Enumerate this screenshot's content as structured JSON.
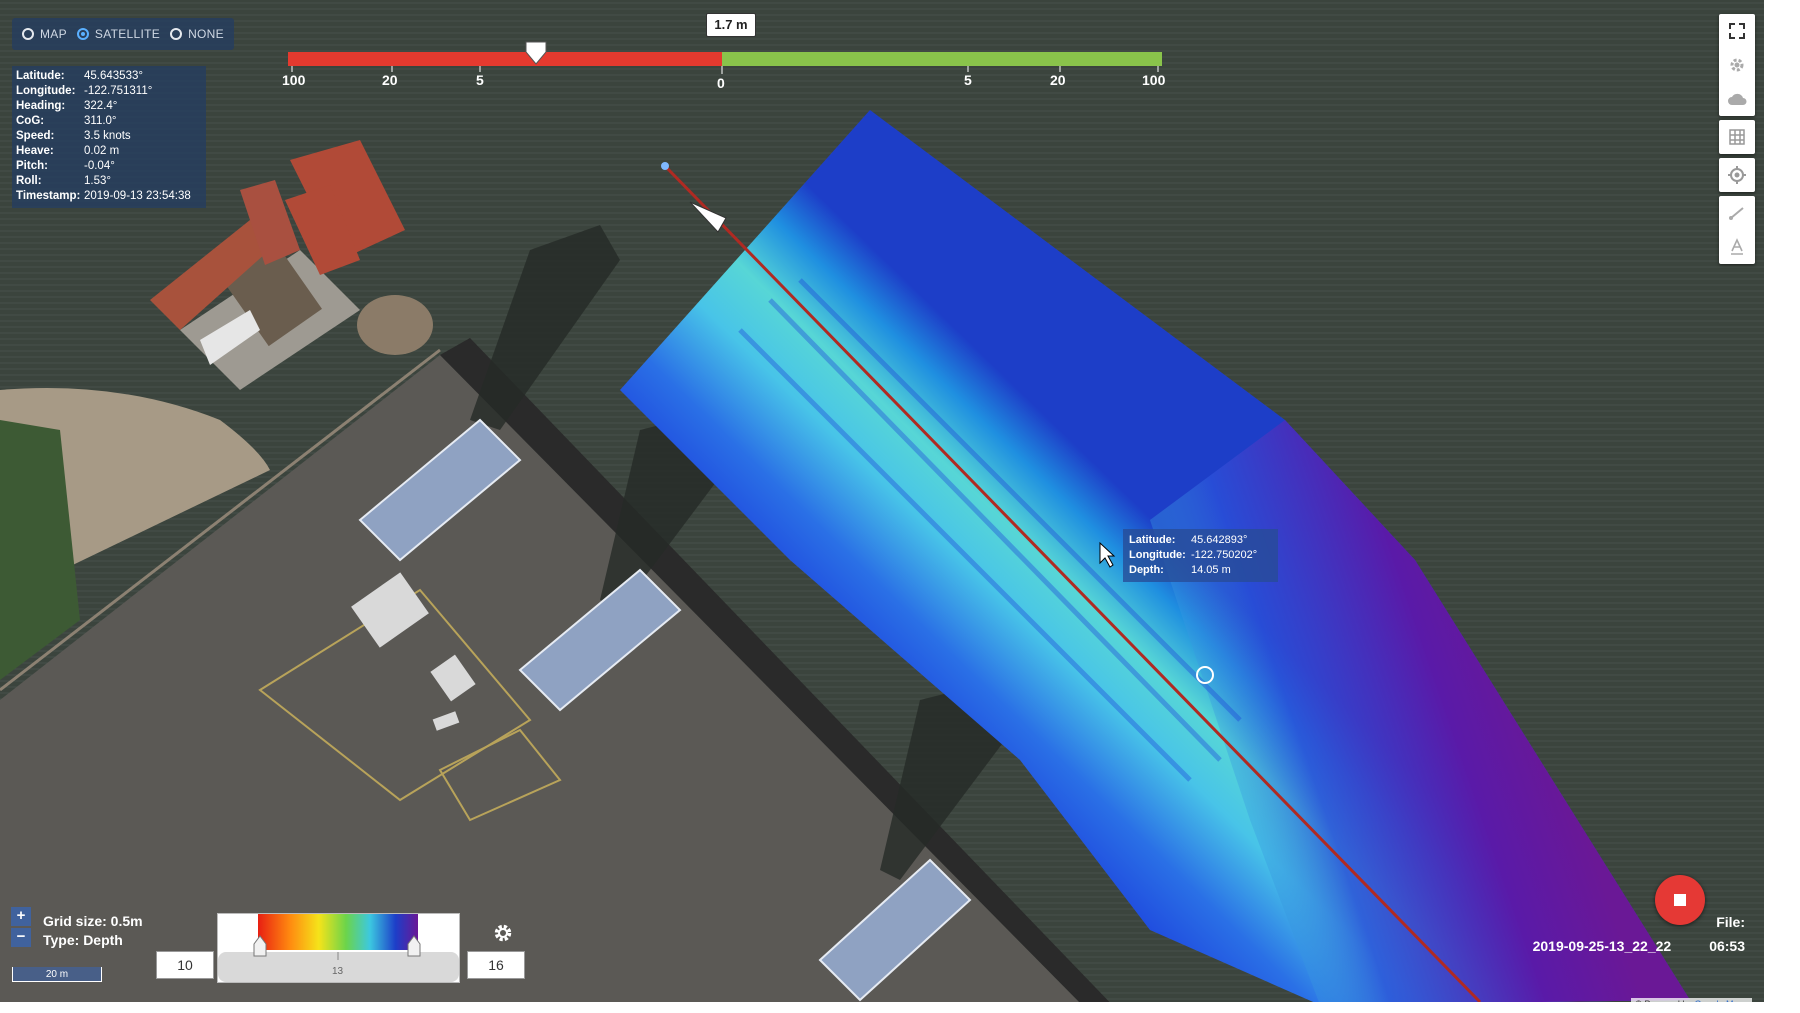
{
  "layer_bar": {
    "options": [
      {
        "label": "MAP",
        "selected": false
      },
      {
        "label": "SATELLITE",
        "selected": true
      },
      {
        "label": "NONE",
        "selected": false
      }
    ]
  },
  "nav": {
    "rows": [
      {
        "k": "Latitude:",
        "v": "45.643533°"
      },
      {
        "k": "Longitude:",
        "v": "-122.751311°"
      },
      {
        "k": "Heading:",
        "v": "322.4°"
      },
      {
        "k": "CoG:",
        "v": "311.0°"
      },
      {
        "k": "Speed:",
        "v": "3.5 knots"
      },
      {
        "k": "Heave:",
        "v": "0.02 m"
      },
      {
        "k": "Pitch:",
        "v": "-0.04°"
      },
      {
        "k": "Roll:",
        "v": "1.53°"
      },
      {
        "k": "Timestamp:",
        "v": "2019-09-13 23:54:38"
      }
    ]
  },
  "gauge": {
    "value_label": "1.7 m",
    "ticks_left": [
      "100",
      "20",
      "5",
      "0"
    ],
    "ticks_right": [
      "5",
      "20",
      "100"
    ],
    "colors": {
      "left": "#e53a2f",
      "right": "#8ac44b"
    }
  },
  "tooltip": {
    "rows": [
      {
        "k": "Latitude:",
        "v": "45.642893°"
      },
      {
        "k": "Longitude:",
        "v": "-122.750202°"
      },
      {
        "k": "Depth:",
        "v": "14.05 m"
      }
    ]
  },
  "toolbar": {
    "icons": [
      "fullscreen-icon",
      "gear-icon",
      "cloud-download-icon",
      "grid-icon",
      "locate-icon",
      "measure-icon",
      "text-icon"
    ]
  },
  "zoom": {
    "plus": "+",
    "minus": "−"
  },
  "grid_info": {
    "grid_size": "Grid size: 0.5m",
    "type": "Type: Depth"
  },
  "scalebar": {
    "label": "20 m"
  },
  "color_scale": {
    "min": "10",
    "max": "16",
    "mid": "13"
  },
  "file_info": {
    "label": "File:",
    "name": "2019-09-25-13_22_22",
    "duration": "06:53"
  },
  "attribution": {
    "prefix": "© Powered by",
    "link": "Google Maps"
  }
}
